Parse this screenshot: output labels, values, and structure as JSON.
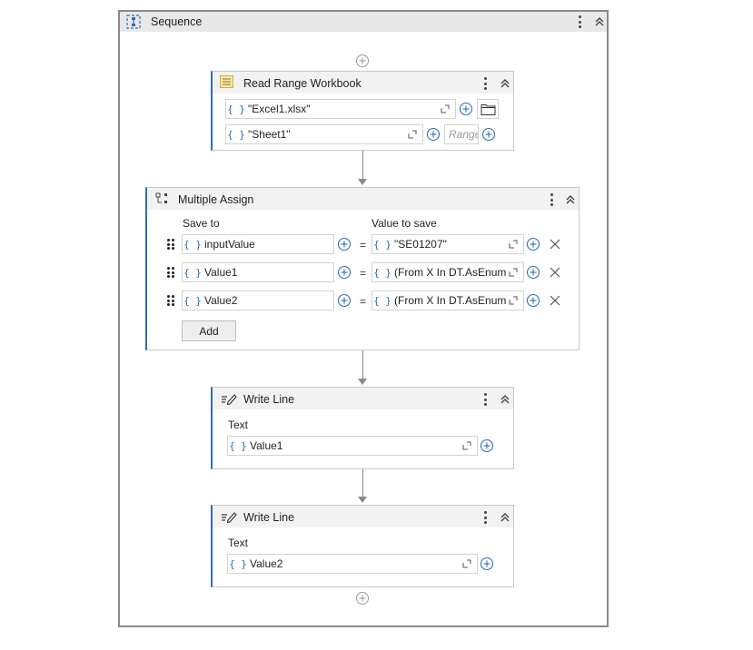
{
  "sequence": {
    "title": "Sequence"
  },
  "read_range": {
    "title": "Read Range Workbook",
    "workbook_path": "\"Excel1.xlsx\"",
    "sheet_name": "\"Sheet1\"",
    "range_placeholder": "Range"
  },
  "multiple_assign": {
    "title": "Multiple Assign",
    "save_to_header": "Save to",
    "value_header": "Value to save",
    "rows": [
      {
        "target": "inputValue",
        "value": "\"SE01207\""
      },
      {
        "target": "Value1",
        "value": "(From X In DT.AsEnum"
      },
      {
        "target": "Value2",
        "value": "(From X In DT.AsEnum"
      }
    ],
    "equals": "=",
    "add_label": "Add"
  },
  "write_line_1": {
    "title": "Write Line",
    "text_label": "Text",
    "text_value": "Value1"
  },
  "write_line_2": {
    "title": "Write Line",
    "text_label": "Text",
    "text_value": "Value2"
  },
  "icons": {
    "brace": "{ }",
    "accent_color": "#2f6db5"
  }
}
